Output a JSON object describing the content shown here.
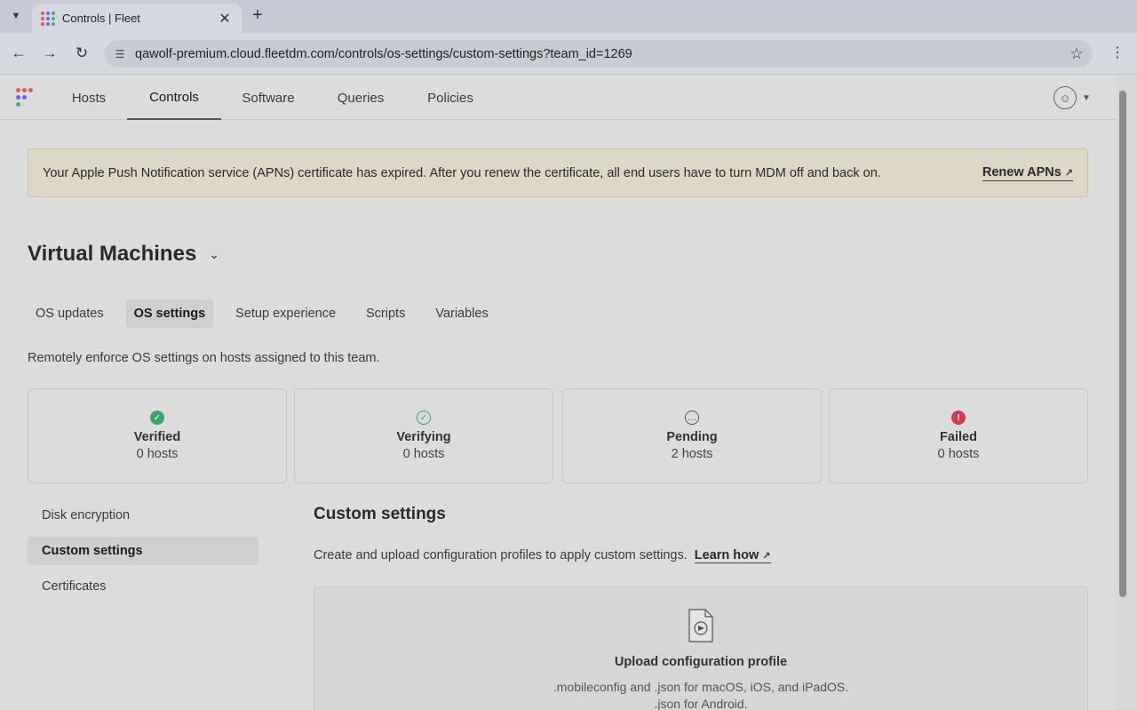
{
  "browser": {
    "tab_title": "Controls | Fleet",
    "url": "qawolf-premium.cloud.fleetdm.com/controls/os-settings/custom-settings?team_id=1269"
  },
  "nav": {
    "items": [
      {
        "label": "Hosts"
      },
      {
        "label": "Controls"
      },
      {
        "label": "Software"
      },
      {
        "label": "Queries"
      },
      {
        "label": "Policies"
      }
    ],
    "active": "Controls"
  },
  "banner": {
    "message": "Your Apple Push Notification service (APNs) certificate has expired. After you renew the certificate, all end users have to turn MDM off and back on.",
    "action": "Renew APNs"
  },
  "team": {
    "name": "Virtual Machines"
  },
  "subtabs": [
    {
      "label": "OS updates"
    },
    {
      "label": "OS settings"
    },
    {
      "label": "Setup experience"
    },
    {
      "label": "Scripts"
    },
    {
      "label": "Variables"
    }
  ],
  "description": "Remotely enforce OS settings on hosts assigned to this team.",
  "status_cards": [
    {
      "label": "Verified",
      "count": "0 hosts",
      "icon": "check-circle-filled-icon",
      "color": "#3aa66a"
    },
    {
      "label": "Verifying",
      "count": "0 hosts",
      "icon": "check-circle-outline-icon",
      "color": "#3aa66a"
    },
    {
      "label": "Pending",
      "count": "2 hosts",
      "icon": "pending-ellipsis-icon",
      "color": "#555555"
    },
    {
      "label": "Failed",
      "count": "0 hosts",
      "icon": "error-icon",
      "color": "#d03a57"
    }
  ],
  "sidenav": [
    {
      "label": "Disk encryption"
    },
    {
      "label": "Custom settings"
    },
    {
      "label": "Certificates"
    }
  ],
  "custom_settings": {
    "title": "Custom settings",
    "description": "Create and upload configuration profiles to apply custom settings.",
    "learn_link": "Learn how",
    "upload_title": "Upload configuration profile",
    "upload_hint_1": ".mobileconfig and .json for macOS, iOS, and iPadOS.",
    "upload_hint_2": ".json for Android."
  }
}
